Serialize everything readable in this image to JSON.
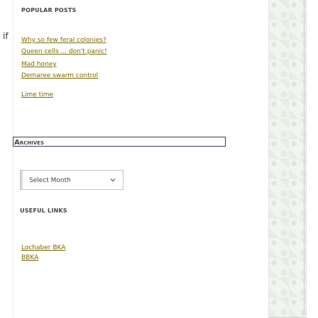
{
  "left_fragment": "if",
  "popular_posts": {
    "title": "POPULAR POSTS",
    "items": [
      "Why so few feral colonies?",
      "Queen cells ... don't panic!",
      "Mad honey",
      "Demaree swarm control",
      "Lime time"
    ]
  },
  "archives": {
    "title_first": "A",
    "title_rest": "RCHIVES",
    "select_label": "Select Month",
    "select_icon": "chevron-down-icon"
  },
  "useful_links": {
    "title": "USEFUL LINKS",
    "items": [
      "Lochaber BKA",
      "BBKA"
    ]
  },
  "colors": {
    "link": "#7a6a00",
    "archives_border": "#2e3f52",
    "pattern_bg": "#f1f4ef"
  }
}
